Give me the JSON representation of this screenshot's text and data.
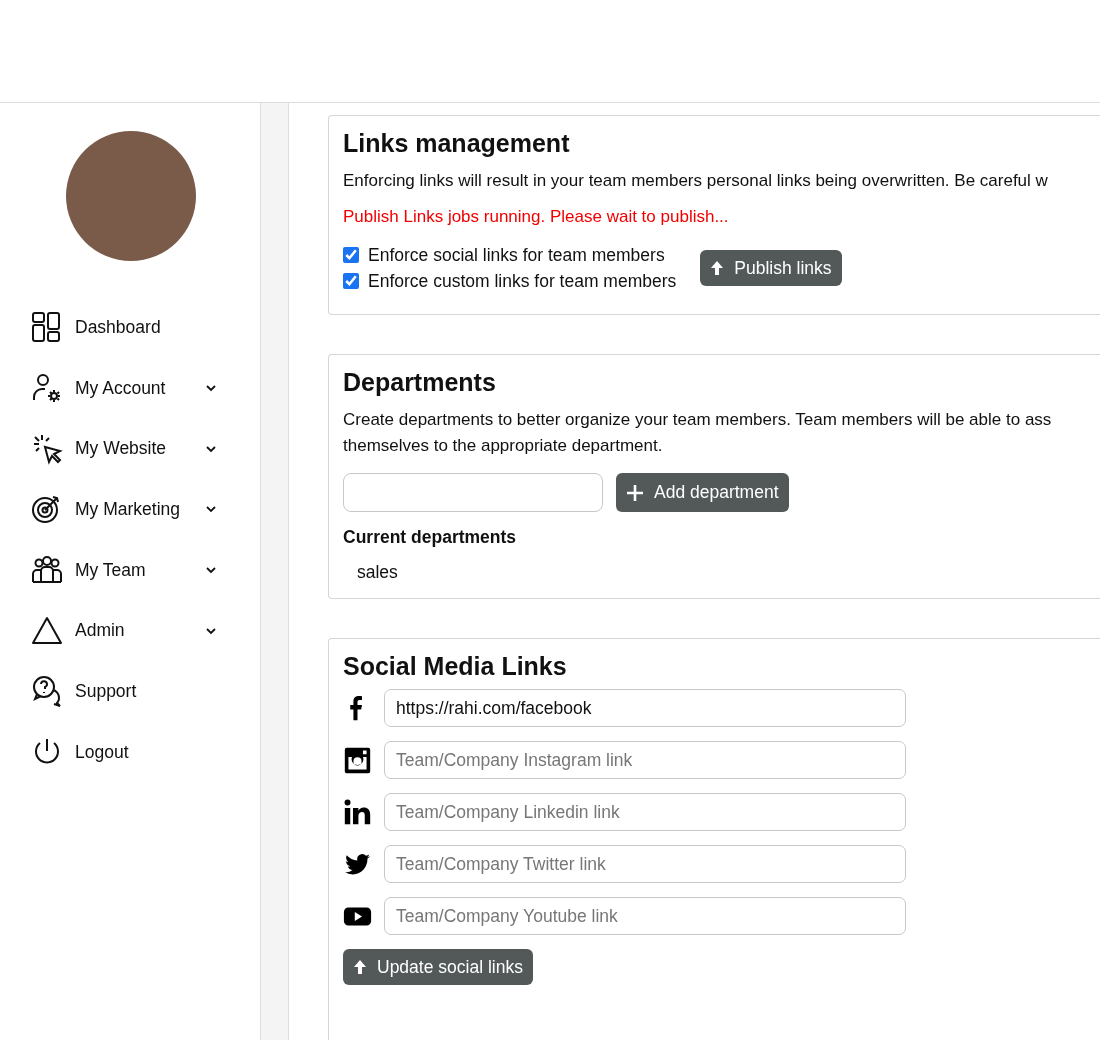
{
  "sidebar": {
    "items": [
      {
        "kind": "dashboard",
        "label": "Dashboard",
        "expandable": false
      },
      {
        "kind": "account",
        "label": "My Account",
        "expandable": true
      },
      {
        "kind": "website",
        "label": "My Website",
        "expandable": true
      },
      {
        "kind": "marketing",
        "label": "My Marketing",
        "expandable": true
      },
      {
        "kind": "team",
        "label": "My Team",
        "expandable": true
      },
      {
        "kind": "admin",
        "label": "Admin",
        "expandable": true
      },
      {
        "kind": "support",
        "label": "Support",
        "expandable": false
      },
      {
        "kind": "logout",
        "label": "Logout",
        "expandable": false
      }
    ]
  },
  "links_management": {
    "title": "Links management",
    "description": "Enforcing links will result in your team members personal links being overwritten. Be careful w",
    "warning": "Publish Links jobs running. Please wait to publish...",
    "options": [
      {
        "label": "Enforce social links for team members",
        "checked": true
      },
      {
        "label": "Enforce custom links for team members",
        "checked": true
      }
    ],
    "button": "Publish links"
  },
  "departments": {
    "title": "Departments",
    "description_lines": [
      "Create departments to better organize your team members. Team members will be able to ass",
      "themselves to the appropriate department."
    ],
    "button": "Add department",
    "list_title": "Current departments",
    "items": [
      "sales"
    ]
  },
  "social_media_links": {
    "title": "Social Media Links",
    "fields": [
      {
        "kind": "facebook",
        "value": "https://rahi.com/facebook"
      },
      {
        "kind": "instagram",
        "placeholder": "Team/Company Instagram link"
      },
      {
        "kind": "linkedin",
        "placeholder": "Team/Company Linkedin link"
      },
      {
        "kind": "twitter",
        "placeholder": "Team/Company Twitter link"
      },
      {
        "kind": "youtube",
        "placeholder": "Team/Company Youtube link"
      }
    ],
    "button": "Update social links"
  }
}
